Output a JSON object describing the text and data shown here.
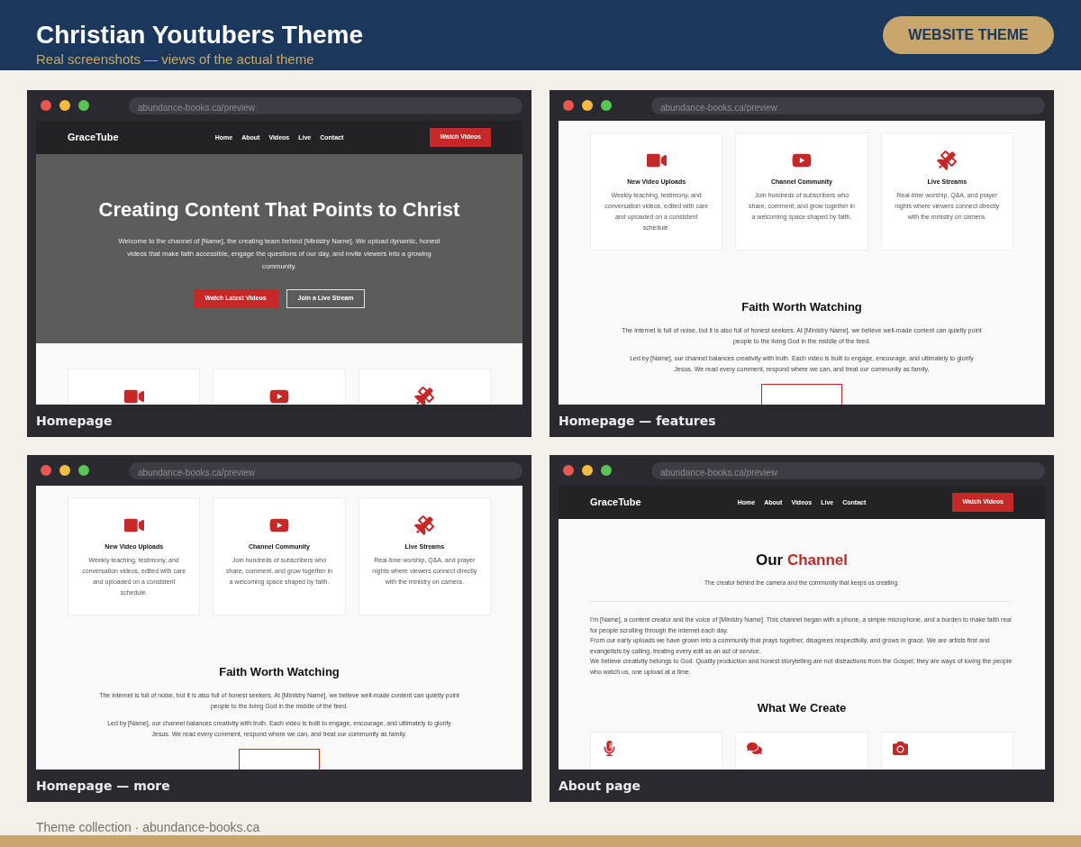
{
  "header": {
    "title": "Christian Youtubers Theme",
    "subtitle": "Real screenshots — views of the actual theme",
    "button": "WEBSITE THEME"
  },
  "panels": [
    {
      "url": "abundance-books.ca/preview",
      "caption": "Homepage",
      "sections": [
        {
          "kind": "nav",
          "logo": "GraceTube",
          "links": [
            "Home",
            "About",
            "Videos",
            "Live",
            "Contact"
          ],
          "cta": "Watch Videos"
        },
        {
          "kind": "hero",
          "title": "Creating Content That Points to Christ",
          "text": "Welcome to the channel of [Name], the creating team behind [Ministry Name]. We upload dynamic, honest videos that make faith accessible, engage the questions of our day, and invite viewers into a growing community.",
          "buttons": [
            {
              "label": "Watch Latest Videos",
              "kind": "primary"
            },
            {
              "label": "Join a Live Stream",
              "kind": "outline"
            }
          ]
        },
        {
          "kind": "cards_peek",
          "cards": [
            {
              "kind": "video"
            },
            {
              "kind": "play"
            },
            {
              "kind": "satellite"
            }
          ]
        }
      ]
    },
    {
      "url": "abundance-books.ca/preview",
      "caption": "Homepage — features",
      "sections": [
        {
          "kind": "feature_cards",
          "cards": [
            {
              "kind": "video",
              "title": "New Video Uploads",
              "text": "Weekly teaching, testimony, and conversation videos, edited with care and uploaded on a consistent schedule."
            },
            {
              "kind": "play",
              "title": "Channel Community",
              "text": "Join hundreds of subscribers who share, comment, and grow together in a welcoming space shaped by faith."
            },
            {
              "kind": "satellite",
              "title": "Live Streams",
              "text": "Real-time worship, Q&A, and prayer nights where viewers connect directly with the ministry on camera."
            }
          ]
        },
        {
          "kind": "intro",
          "title": "Faith Worth Watching",
          "paragraphs": [
            "The internet is full of noise, but it is also full of honest seekers. At [Ministry Name], we believe well-made content can quietly point people to the living God in the middle of the feed.",
            "Led by [Name], our channel balances creativity with truth. Each video is built to engage, encourage, and ultimately to glorify Jesus. We read every comment, respond where we can, and treat our community as family."
          ],
          "button_visible": true
        }
      ]
    },
    {
      "url": "abundance-books.ca/preview",
      "caption": "Homepage — more",
      "sections": [
        {
          "kind": "feature_cards",
          "cards": [
            {
              "kind": "video",
              "title": "New Video Uploads",
              "text": "Weekly teaching, testimony, and conversation videos, edited with care and uploaded on a consistent schedule."
            },
            {
              "kind": "play",
              "title": "Channel Community",
              "text": "Join hundreds of subscribers who share, comment, and grow together in a welcoming space shaped by faith."
            },
            {
              "kind": "satellite",
              "title": "Live Streams",
              "text": "Real-time worship, Q&A, and prayer nights where viewers connect directly with the ministry on camera."
            }
          ]
        },
        {
          "kind": "intro",
          "title": "Faith Worth Watching",
          "paragraphs": [
            "The internet is full of noise, but it is also full of honest seekers. At [Ministry Name], we believe well-made content can quietly point people to the living God in the middle of the feed.",
            "Led by [Name], our channel balances creativity with truth. Each video is built to engage, encourage, and ultimately to glorify Jesus. We read every comment, respond where we can, and treat our community as family."
          ],
          "button_visible": true
        }
      ]
    },
    {
      "url": "abundance-books.ca/preview",
      "caption": "About page",
      "sections": [
        {
          "kind": "nav",
          "logo": "GraceTube",
          "links": [
            "Home",
            "About",
            "Videos",
            "Live",
            "Contact"
          ],
          "cta": "Watch Videos"
        },
        {
          "kind": "about",
          "heading_lead": "Our",
          "heading_accent": "Channel",
          "subtitle": "The creator behind the camera and the community that keeps us creating.",
          "paragraphs": [
            "I'm [Name], a content creator and the voice of [Ministry Name]. This channel began with a phone, a simple microphone, and a burden to make faith real for people scrolling through the internet each day.",
            "From our early uploads we have grown into a community that prays together, disagrees respectfully, and grows in grace. We are artists first and evangelists by calling, treating every edit as an act of service.",
            "We believe creativity belongs to God. Quality production and honest storytelling are not distractions from the Gospel; they are ways of loving the people who watch us, one upload at a time."
          ],
          "section_title": "What We Create"
        },
        {
          "kind": "create_cards",
          "cards": [
            {
              "kind": "mic"
            },
            {
              "kind": "chat"
            },
            {
              "kind": "camera"
            }
          ]
        }
      ]
    }
  ],
  "footer": {
    "text": "Theme collection · abundance-books.ca"
  }
}
